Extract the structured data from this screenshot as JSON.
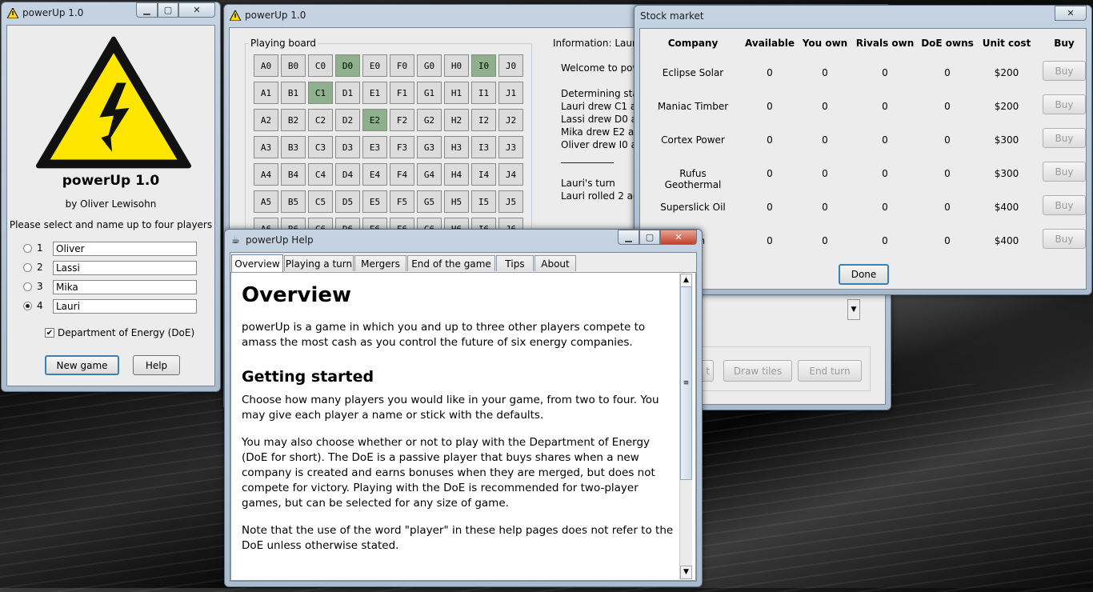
{
  "setup": {
    "title": "powerUp 1.0",
    "heading": "powerUp 1.0",
    "author": "by Oliver Lewisohn",
    "prompt": "Please select and name up to four players",
    "players": [
      {
        "num": "1",
        "name": "Oliver",
        "selected": false
      },
      {
        "num": "2",
        "name": "Lassi",
        "selected": false
      },
      {
        "num": "3",
        "name": "Mika",
        "selected": false
      },
      {
        "num": "4",
        "name": "Lauri",
        "selected": true
      }
    ],
    "doe_label": "Department of Energy (DoE)",
    "doe_checked": true,
    "new_game": "New game",
    "help": "Help"
  },
  "main": {
    "title": "powerUp 1.0",
    "board_label": "Playing board",
    "columns": [
      "A",
      "B",
      "C",
      "D",
      "E",
      "F",
      "G",
      "H",
      "I",
      "J"
    ],
    "rows": [
      "0",
      "1",
      "2",
      "3",
      "4",
      "5",
      "6"
    ],
    "highlighted": [
      "D0",
      "I0",
      "C1",
      "E2"
    ],
    "info_label": "Information: Lauri's",
    "info_lines": [
      "Welcome to pow",
      "",
      "Determining star",
      "Lauri drew C1 an",
      "Lassi drew D0 a",
      "Mika drew E2 an",
      "Oliver drew I0 an",
      "___________",
      "",
      "Lauri's turn",
      "Lauri rolled 2 act"
    ],
    "btn_partial": "t",
    "draw_tiles": "Draw tiles",
    "end_turn": "End turn"
  },
  "stock": {
    "title": "Stock market",
    "headers": [
      "Company",
      "Available",
      "You own",
      "Rivals own",
      "DoE owns",
      "Unit cost",
      "Buy"
    ],
    "rows": [
      {
        "company": "Eclipse Solar",
        "available": "0",
        "you": "0",
        "rivals": "0",
        "doe": "0",
        "cost": "$200",
        "buy": "Buy"
      },
      {
        "company": "Maniac Timber",
        "available": "0",
        "you": "0",
        "rivals": "0",
        "doe": "0",
        "cost": "$200",
        "buy": "Buy"
      },
      {
        "company": "Cortex Power",
        "available": "0",
        "you": "0",
        "rivals": "0",
        "doe": "0",
        "cost": "$300",
        "buy": "Buy"
      },
      {
        "company": "Rufus Geothermal",
        "available": "0",
        "you": "0",
        "rivals": "0",
        "doe": "0",
        "cost": "$300",
        "buy": "Buy"
      },
      {
        "company": "Superslick Oil",
        "available": "0",
        "you": "0",
        "rivals": "0",
        "doe": "0",
        "cost": "$400",
        "buy": "Buy"
      },
      {
        "company": "nium",
        "available": "0",
        "you": "0",
        "rivals": "0",
        "doe": "0",
        "cost": "$400",
        "buy": "Buy"
      }
    ],
    "done": "Done"
  },
  "help": {
    "title": "powerUp Help",
    "tabs": [
      "Overview",
      "Playing a turn",
      "Mergers",
      "End of the game",
      "Tips",
      "About"
    ],
    "h1": "Overview",
    "p1": "powerUp is a game in which you and up to three other players compete to amass the most cash as you control the future of six energy companies.",
    "h2": "Getting started",
    "p2": "Choose how many players you would like in your game, from two to four. You may give each player a name or stick with the defaults.",
    "p3": "You may also choose whether or not to play with the Department of Energy (DoE for short). The DoE is a passive player that buys shares when a new company is created and earns bonuses when they are merged, but does not compete for victory. Playing with the DoE is recommended for two-player games, but can be selected for any size of game.",
    "p4": "Note that the use of the word \"player\" in these help pages does not refer to the DoE unless otherwise stated."
  },
  "icons": {
    "warning": "warning-triangle-icon",
    "java": "java-cup-icon"
  },
  "colors": {
    "tile_highlight": "#8fb08c",
    "warning_yellow": "#ffe600"
  }
}
